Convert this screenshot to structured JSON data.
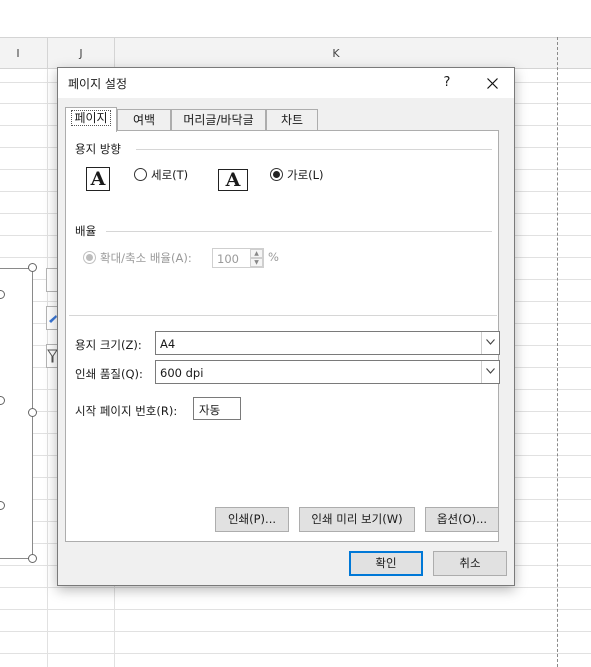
{
  "spreadsheet": {
    "columns": [
      "I",
      "J",
      "K"
    ]
  },
  "dialog": {
    "title": "페이지 설정",
    "help_label": "?",
    "tabs": [
      {
        "label": "페이지",
        "active": true
      },
      {
        "label": "여백",
        "active": false
      },
      {
        "label": "머리글/바닥글",
        "active": false
      },
      {
        "label": "차트",
        "active": false
      }
    ],
    "orientation": {
      "group_label": "용지 방향",
      "icon_glyph": "A",
      "portrait_label": "세로(T)",
      "landscape_label": "가로(L)",
      "selected": "landscape"
    },
    "scaling": {
      "group_label": "배율",
      "zoom_label": "확대/축소 배율(A):",
      "zoom_value": "100",
      "percent_sign": "%",
      "enabled": false
    },
    "paper_size": {
      "label": "용지 크기(Z):",
      "value": "A4"
    },
    "print_quality": {
      "label": "인쇄 품질(Q):",
      "value": "600 dpi"
    },
    "first_page_number": {
      "label": "시작 페이지 번호(R):",
      "value": "자동"
    },
    "buttons": {
      "print": "인쇄(P)...",
      "print_preview": "인쇄 미리 보기(W)",
      "options": "옵션(O)...",
      "ok": "확인",
      "cancel": "취소"
    }
  },
  "colors": {
    "accent": "#0078d7",
    "dialog_bg": "#f0f0f0"
  }
}
